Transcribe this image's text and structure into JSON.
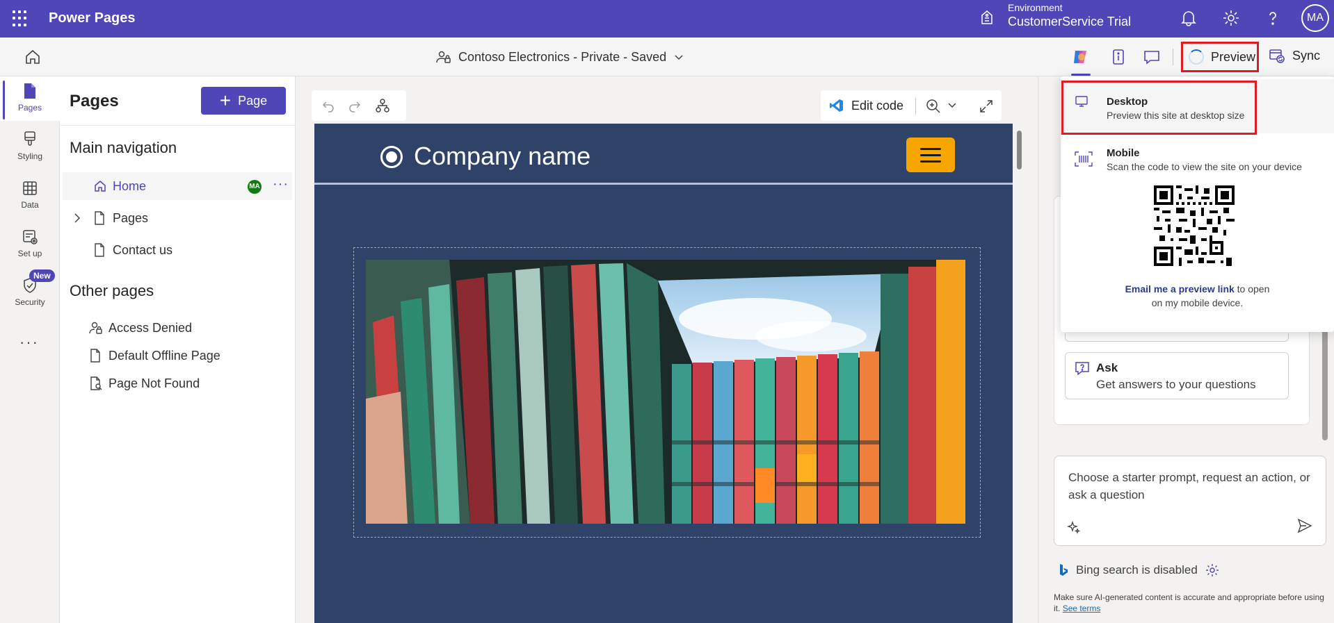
{
  "topbar": {
    "app_name": "Power Pages",
    "environment_label": "Environment",
    "environment_name": "CustomerService Trial",
    "avatar_initials": "MA",
    "brand_color": "#4f46b8"
  },
  "cmdbar": {
    "site_title": "Contoso Electronics - Private - Saved",
    "preview_label": "Preview",
    "sync_label": "Sync"
  },
  "rail": {
    "items": [
      {
        "label": "Pages",
        "icon": "pages-icon"
      },
      {
        "label": "Styling",
        "icon": "brush-icon"
      },
      {
        "label": "Data",
        "icon": "table-icon"
      },
      {
        "label": "Set up",
        "icon": "setup-icon"
      },
      {
        "label": "Security",
        "icon": "shield-icon"
      }
    ],
    "new_badge": "New",
    "more": "···"
  },
  "pages_panel": {
    "title": "Pages",
    "add_button": "Page",
    "main_nav_heading": "Main navigation",
    "main_nav": [
      "Home",
      "Pages",
      "Contact us"
    ],
    "home_badge": "MA",
    "row_more": "···",
    "other_heading": "Other pages",
    "other_pages": [
      "Access Denied",
      "Default Offline Page",
      "Page Not Found"
    ]
  },
  "canvas": {
    "edit_code_label": "Edit code",
    "company_name": "Company name",
    "header_color": "#2e4367",
    "menu_button_color": "#f7a600"
  },
  "copilot": {
    "ask_title": "Ask",
    "ask_subtitle": "Get answers to your questions",
    "chat_placeholder": "Choose a starter prompt, request an action, or ask a question",
    "bing_status": "Bing search is disabled",
    "disclaimer": "Make sure AI-generated content is accurate and appropriate before using it.",
    "see_terms": "See terms"
  },
  "preview_menu": {
    "desktop_title": "Desktop",
    "desktop_sub": "Preview this site at desktop size",
    "mobile_title": "Mobile",
    "mobile_sub": "Scan the code to view the site on your device",
    "email_link": "Email me a preview link",
    "email_rest": " to open",
    "email_line2": "on my mobile device."
  }
}
